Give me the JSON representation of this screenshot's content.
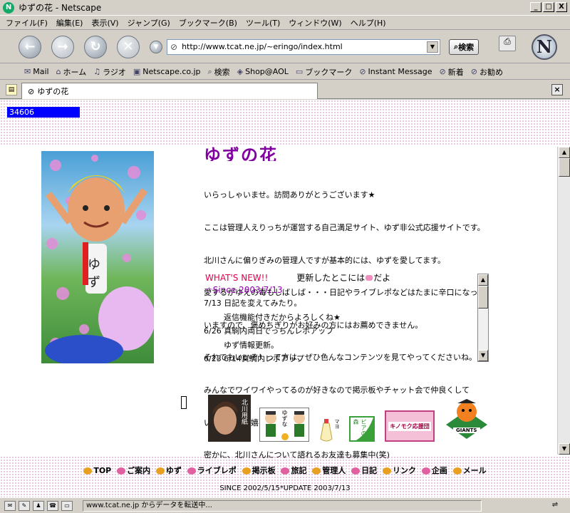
{
  "window": {
    "title": "ゆずの花 - Netscape",
    "controls": {
      "minimize": "_",
      "maximize": "□",
      "close": "X"
    }
  },
  "menu": [
    "ファイル(F)",
    "編集(E)",
    "表示(V)",
    "ジャンプ(G)",
    "ブックマーク(B)",
    "ツール(T)",
    "ウィンドウ(W)",
    "ヘルプ(H)"
  ],
  "navigation": {
    "url": "http://www.tcat.ne.jp/~eringo/index.html",
    "search_label": "検索"
  },
  "bookmarks": [
    {
      "icon": "mail-icon",
      "glyph": "✉",
      "label": "Mail"
    },
    {
      "icon": "home-icon",
      "glyph": "⌂",
      "label": "ホーム"
    },
    {
      "icon": "radio-icon",
      "glyph": "♫",
      "label": "ラジオ"
    },
    {
      "icon": "my-netscape-icon",
      "glyph": "▣",
      "label": "Netscape.co.jp"
    },
    {
      "icon": "search-icon",
      "glyph": "⌕",
      "label": "検索"
    },
    {
      "icon": "shop-icon",
      "glyph": "◈",
      "label": "Shop@AOL"
    },
    {
      "icon": "folder-icon",
      "glyph": "▭",
      "label": "ブックマーク"
    },
    {
      "icon": "link-icon",
      "glyph": "⊘",
      "label": "Instant Message"
    },
    {
      "icon": "link-icon",
      "glyph": "⊘",
      "label": "新着"
    },
    {
      "icon": "link-icon",
      "glyph": "⊘",
      "label": "お勧め"
    }
  ],
  "tab": {
    "title": "ゆずの花"
  },
  "page": {
    "counter": "34606",
    "header": "ゆずの花",
    "intro_lines": [
      "いらっしゃいませ。訪問ありがとうございます★",
      "ここは管理人えりっちが運営する自己満足サイト、ゆず非公式応援サイトです。",
      "北川さんに偏りぎみの管理人ですが基本的には、ゆずを愛してます。",
      "愛するがゆえの毒もしばしば・・・日記やライブレポなどはたまに辛口になって",
      "いますので、褒めちぎりがお好みの方にはお薦めできません。",
      "それでもいいぞ！って方は、ぜひ色んなコンテンツを見てやってくださいね。",
      "みんなでワイワイやってるのが好きなので掲示板やチャット会で仲良くして",
      "いただけたら嬉しいです。",
      "密かに、北川さんについて語れるお友達も募集中(笑)"
    ],
    "news": {
      "title": "WHAT'S NEW!!",
      "subtitle_pre": "更新したとこには",
      "subtitle_post": "だよ",
      "since": "☆Since  2003/7/13",
      "items": [
        "7/13 日記を変えてみたり。",
        "        返信機能付きだからよろしくね★",
        "6/26 真駒内両日でっちんレポアップ",
        "        ゆず情報更新。",
        "6/23 6/14真駒内レポアップ"
      ]
    },
    "banners": {
      "photo": "北川用紙",
      "cartoon": "ゆずな",
      "mayo": "マヨ",
      "forest": "ビアの森",
      "label": "キノモク応援団",
      "giants": "GIANTS"
    },
    "footer_links": [
      "TOP",
      "ご案内",
      "ゆず",
      "ライブレポ",
      "掲示板",
      "旅記",
      "管理人",
      "日記",
      "リンク",
      "企画",
      "メール"
    ],
    "since_update": "SINCE 2002/5/15*UPDATE 2003/7/13"
  },
  "status": {
    "text": "www.tcat.ne.jp からデータを転送中..."
  }
}
